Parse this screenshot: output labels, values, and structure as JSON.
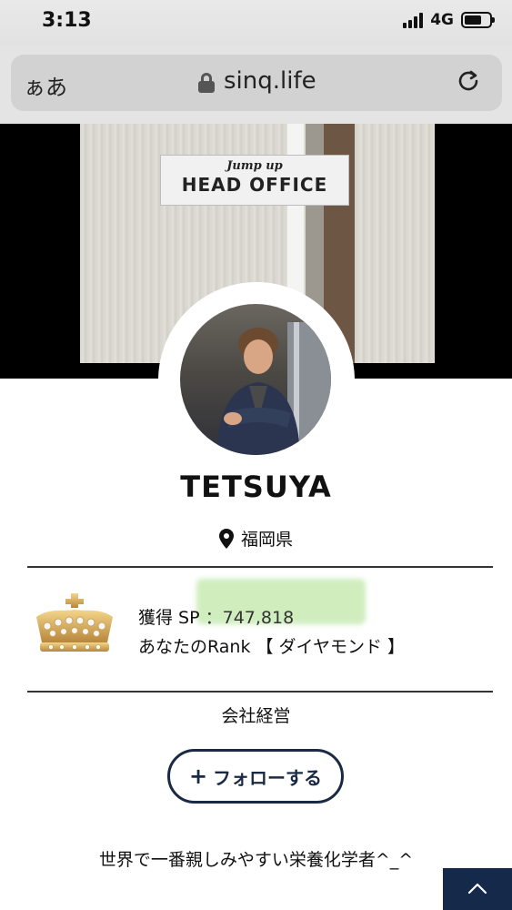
{
  "status_bar": {
    "time": "3:13",
    "network": "4G"
  },
  "browser": {
    "text_size": "ぁあ",
    "url": "sinq.life"
  },
  "cover": {
    "sign_brand": "Jump up",
    "sign_text": "HEAD OFFICE"
  },
  "profile": {
    "name": "TETSUYA",
    "location": "福岡県",
    "sp_label": "獲得 SP",
    "sp_value": "：747,818",
    "rank_text": "あなたのRank 【 ダイヤモンド 】",
    "job": "会社経営",
    "follow_label": "フォローする",
    "follow_plus": "+",
    "bio": "世界で一番親しみやすい栄養化学者^_^"
  },
  "icons": [
    "lock-icon",
    "reload-icon",
    "location-pin-icon",
    "crown-icon",
    "chevron-up-icon"
  ],
  "colors": {
    "accent": "#15294a",
    "highlight": "#bfe7a8"
  }
}
